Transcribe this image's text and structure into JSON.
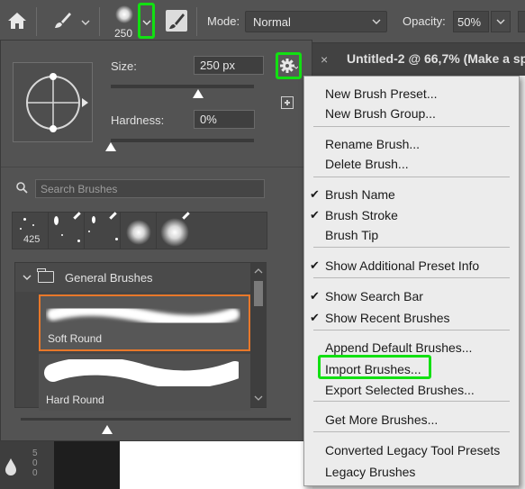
{
  "options_bar": {
    "brush_size": "250",
    "mode_label": "Mode:",
    "mode_value": "Normal",
    "opacity_label": "Opacity:",
    "opacity_value": "50%"
  },
  "document": {
    "tab_title": "Untitled-2 @ 66,7% (Make a sp"
  },
  "panel": {
    "size_label": "Size:",
    "size_value": "250 px",
    "size_level": 0.61,
    "hardness_label": "Hardness:",
    "hardness_value": "0%",
    "hardness_level": 0.0,
    "search_placeholder": "Search Brushes",
    "recent_count": "425",
    "group_name": "General Brushes",
    "brushes": [
      {
        "name": "Soft Round",
        "selected": true
      },
      {
        "name": "Hard Round",
        "selected": false
      }
    ],
    "preview_size_level": 0.32
  },
  "menu": {
    "items": [
      {
        "label": "New Brush Preset...",
        "checked": false
      },
      {
        "label": "New Brush Group...",
        "checked": false
      },
      {
        "label": "Rename Brush...",
        "checked": false
      },
      {
        "label": "Delete Brush...",
        "checked": false
      },
      {
        "label": "Brush Name",
        "checked": true
      },
      {
        "label": "Brush Stroke",
        "checked": true
      },
      {
        "label": "Brush Tip",
        "checked": false
      },
      {
        "label": "Show Additional Preset Info",
        "checked": true
      },
      {
        "label": "Show Search Bar",
        "checked": true
      },
      {
        "label": "Show Recent Brushes",
        "checked": true
      },
      {
        "label": "Append Default Brushes...",
        "checked": false
      },
      {
        "label": "Import Brushes...",
        "checked": false
      },
      {
        "label": "Export Selected Brushes...",
        "checked": false
      },
      {
        "label": "Get More Brushes...",
        "checked": false
      },
      {
        "label": "Converted Legacy Tool Presets",
        "checked": false
      },
      {
        "label": "Legacy Brushes",
        "checked": false
      }
    ]
  },
  "colors": {
    "highlight": "#12e012",
    "selection": "#e8782a",
    "panel_bg": "#535353",
    "menu_bg": "#ececec"
  },
  "icons": [
    "home-icon",
    "brush-icon",
    "pressure-icon",
    "gear-icon",
    "new-preset-icon",
    "search-icon",
    "folder-icon",
    "chevron-down-icon"
  ]
}
